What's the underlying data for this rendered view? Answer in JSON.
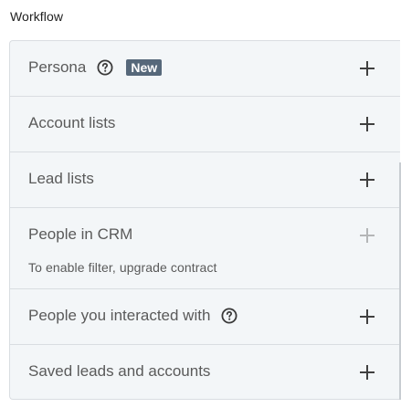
{
  "section": {
    "title": "Workflow"
  },
  "filters": [
    {
      "label": "Persona",
      "help": true,
      "badge": "New",
      "enabled": true
    },
    {
      "label": "Account lists",
      "enabled": true
    },
    {
      "label": "Lead lists",
      "enabled": true
    },
    {
      "label": "People in CRM",
      "enabled": false,
      "note": "To enable filter, upgrade contract"
    },
    {
      "label": "People you interacted with",
      "help": true,
      "enabled": true
    },
    {
      "label": "Saved leads and accounts",
      "enabled": true
    }
  ],
  "icons": {
    "help": "question-circle-icon",
    "add": "plus-icon"
  },
  "colors": {
    "panel_bg": "#f3f6f8",
    "badge_bg": "#56687a",
    "text": "#5a5a5a",
    "border": "#d9dde1"
  }
}
